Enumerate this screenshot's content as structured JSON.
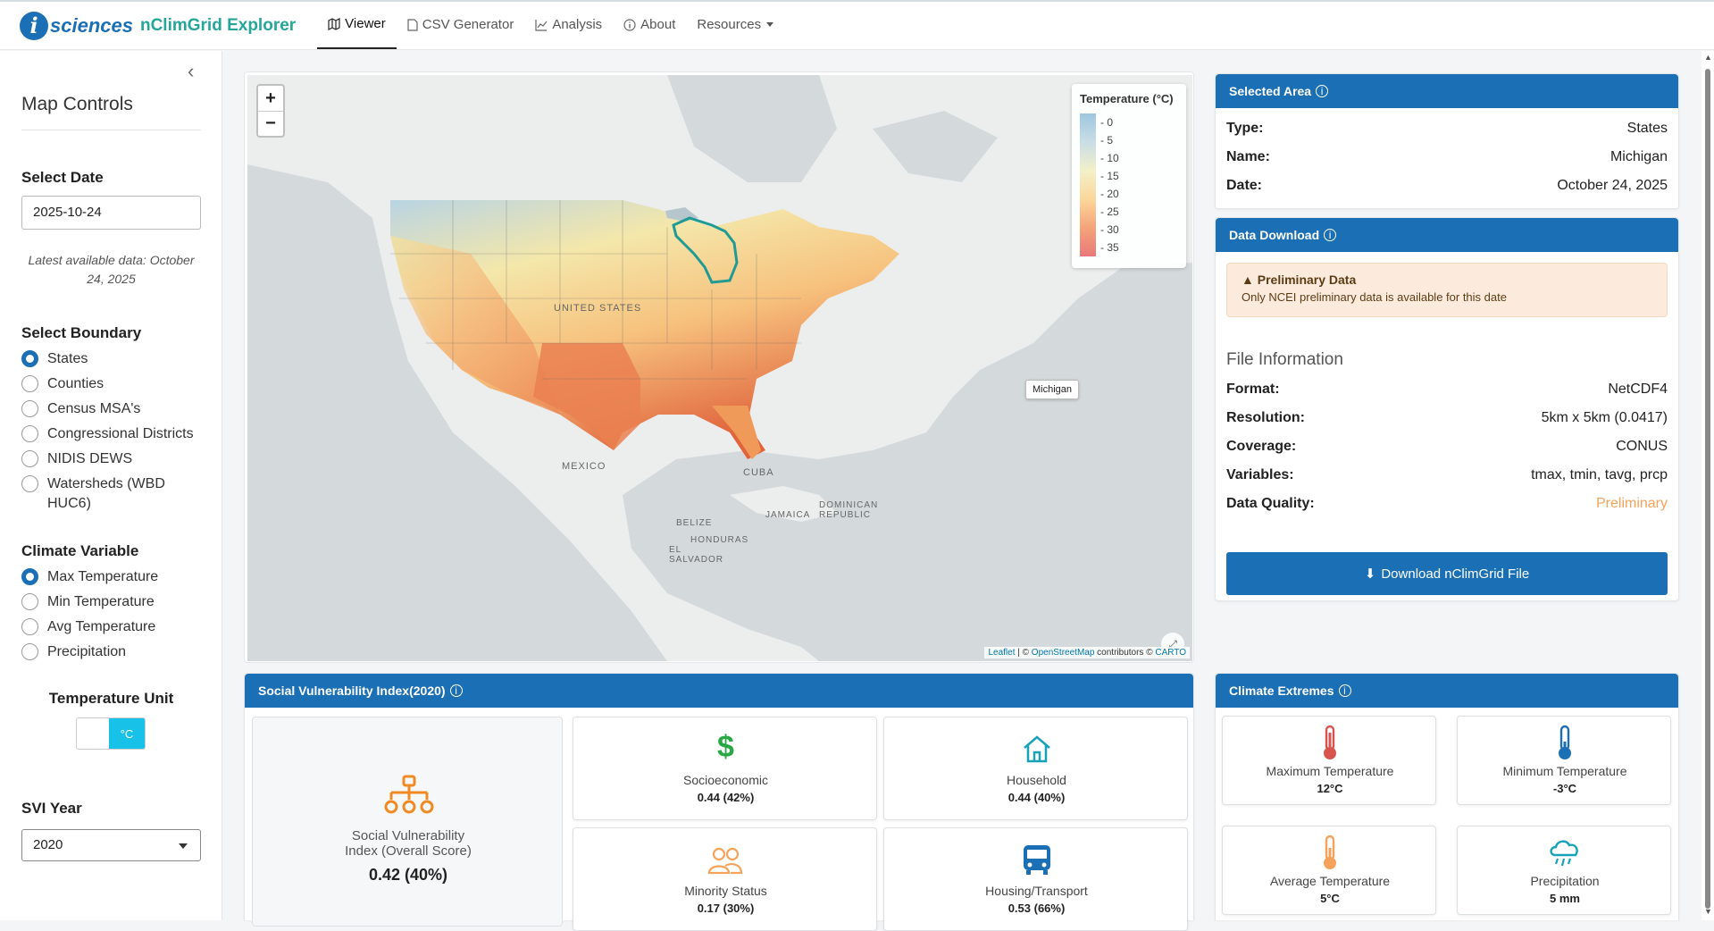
{
  "brand": {
    "logo_letter": "i",
    "name": "sciences",
    "app": "nClimGrid Explorer"
  },
  "nav": [
    {
      "label": "Viewer",
      "icon": "map-icon",
      "active": true
    },
    {
      "label": "CSV Generator",
      "icon": "file-icon"
    },
    {
      "label": "Analysis",
      "icon": "chart-line-icon"
    },
    {
      "label": "About",
      "icon": "info-icon"
    },
    {
      "label": "Resources",
      "icon": "caret-down-icon"
    }
  ],
  "sidebar": {
    "title": "Map Controls",
    "date_label": "Select Date",
    "date_value": "2025-10-24",
    "latest_note": "Latest available data: October 24, 2025",
    "boundary_label": "Select Boundary",
    "boundaries": [
      "States",
      "Counties",
      "Census MSA's",
      "Congressional Districts",
      "NIDIS DEWS",
      "Watersheds (WBD HUC6)"
    ],
    "boundary_selected": "States",
    "variable_label": "Climate Variable",
    "variables": [
      "Max Temperature",
      "Min Temperature",
      "Avg Temperature",
      "Precipitation"
    ],
    "variable_selected": "Max Temperature",
    "unit_label": "Temperature Unit",
    "unit_value": "°C",
    "svi_label": "SVI Year",
    "svi_value": "2020"
  },
  "map": {
    "zoom_in": "+",
    "zoom_out": "−",
    "legend_title": "Temperature (°C)",
    "legend_ticks": [
      "0",
      "5",
      "10",
      "15",
      "20",
      "25",
      "30",
      "35"
    ],
    "tooltip": "Michigan",
    "labels": {
      "us": "UNITED STATES",
      "mexico": "MEXICO",
      "cuba": "CUBA",
      "dr": "DOMINICAN REPUBLIC",
      "jamaica": "JAMAICA",
      "belize": "BELIZE",
      "honduras": "HONDURAS",
      "salvador": "EL SALVADOR"
    },
    "attribution": {
      "leaflet": "Leaflet",
      "sep": " | © ",
      "osm": "OpenStreetMap",
      "contrib": " contributors © ",
      "carto": "CARTO"
    }
  },
  "selected_area": {
    "title": "Selected Area",
    "rows": [
      {
        "k": "Type:",
        "v": "States"
      },
      {
        "k": "Name:",
        "v": "Michigan"
      },
      {
        "k": "Date:",
        "v": "October 24, 2025"
      }
    ]
  },
  "data_download": {
    "title": "Data Download",
    "alert_title": "Preliminary Data",
    "alert_text": "Only NCEI preliminary data is available for this date",
    "file_info_title": "File Information",
    "rows": [
      {
        "k": "Format:",
        "v": "NetCDF4"
      },
      {
        "k": "Resolution:",
        "v": "5km x 5km (0.0417)"
      },
      {
        "k": "Coverage:",
        "v": "CONUS"
      },
      {
        "k": "Variables:",
        "v": "tmax, tmin, tavg, prcp"
      },
      {
        "k": "Data Quality:",
        "v": "Preliminary"
      }
    ],
    "button": "Download nClimGrid File",
    "quality_color": "#f5a35b"
  },
  "svi": {
    "title": "Social Vulnerability Index(2020)",
    "overall_name": "Social Vulnerability Index (Overall Score)",
    "overall_value": "0.42 (40%)",
    "themes": [
      {
        "name": "Socioeconomic",
        "value": "0.44 (42%)",
        "icon": "dollar-icon",
        "color": "#28a745"
      },
      {
        "name": "Household",
        "value": "0.44 (40%)",
        "icon": "house-icon",
        "color": "#17a2b8"
      },
      {
        "name": "Minority Status",
        "value": "0.17 (30%)",
        "icon": "people-icon",
        "color": "#f5a35b"
      },
      {
        "name": "Housing/Transport",
        "value": "0.53 (66%)",
        "icon": "bus-icon",
        "color": "#1b6fb5"
      }
    ]
  },
  "extremes": {
    "title": "Climate Extremes",
    "items": [
      {
        "name": "Maximum Temperature",
        "value": "12°C",
        "icon": "thermometer-hot-icon",
        "color": "#d9534f"
      },
      {
        "name": "Minimum Temperature",
        "value": "-3°C",
        "icon": "thermometer-cold-icon",
        "color": "#1b6fb5"
      },
      {
        "name": "Average Temperature",
        "value": "5°C",
        "icon": "thermometer-avg-icon",
        "color": "#f5a35b"
      },
      {
        "name": "Precipitation",
        "value": "5 mm",
        "icon": "rain-cloud-icon",
        "color": "#17a2b8"
      }
    ]
  }
}
